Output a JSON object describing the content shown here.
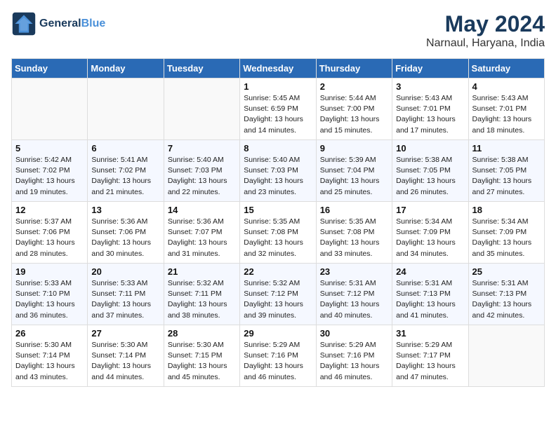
{
  "header": {
    "logo_line1": "General",
    "logo_line2": "Blue",
    "month_year": "May 2024",
    "location": "Narnaul, Haryana, India"
  },
  "weekdays": [
    "Sunday",
    "Monday",
    "Tuesday",
    "Wednesday",
    "Thursday",
    "Friday",
    "Saturday"
  ],
  "weeks": [
    [
      {
        "day": "",
        "info": ""
      },
      {
        "day": "",
        "info": ""
      },
      {
        "day": "",
        "info": ""
      },
      {
        "day": "1",
        "info": "Sunrise: 5:45 AM\nSunset: 6:59 PM\nDaylight: 13 hours and 14 minutes."
      },
      {
        "day": "2",
        "info": "Sunrise: 5:44 AM\nSunset: 7:00 PM\nDaylight: 13 hours and 15 minutes."
      },
      {
        "day": "3",
        "info": "Sunrise: 5:43 AM\nSunset: 7:01 PM\nDaylight: 13 hours and 17 minutes."
      },
      {
        "day": "4",
        "info": "Sunrise: 5:43 AM\nSunset: 7:01 PM\nDaylight: 13 hours and 18 minutes."
      }
    ],
    [
      {
        "day": "5",
        "info": "Sunrise: 5:42 AM\nSunset: 7:02 PM\nDaylight: 13 hours and 19 minutes."
      },
      {
        "day": "6",
        "info": "Sunrise: 5:41 AM\nSunset: 7:02 PM\nDaylight: 13 hours and 21 minutes."
      },
      {
        "day": "7",
        "info": "Sunrise: 5:40 AM\nSunset: 7:03 PM\nDaylight: 13 hours and 22 minutes."
      },
      {
        "day": "8",
        "info": "Sunrise: 5:40 AM\nSunset: 7:03 PM\nDaylight: 13 hours and 23 minutes."
      },
      {
        "day": "9",
        "info": "Sunrise: 5:39 AM\nSunset: 7:04 PM\nDaylight: 13 hours and 25 minutes."
      },
      {
        "day": "10",
        "info": "Sunrise: 5:38 AM\nSunset: 7:05 PM\nDaylight: 13 hours and 26 minutes."
      },
      {
        "day": "11",
        "info": "Sunrise: 5:38 AM\nSunset: 7:05 PM\nDaylight: 13 hours and 27 minutes."
      }
    ],
    [
      {
        "day": "12",
        "info": "Sunrise: 5:37 AM\nSunset: 7:06 PM\nDaylight: 13 hours and 28 minutes."
      },
      {
        "day": "13",
        "info": "Sunrise: 5:36 AM\nSunset: 7:06 PM\nDaylight: 13 hours and 30 minutes."
      },
      {
        "day": "14",
        "info": "Sunrise: 5:36 AM\nSunset: 7:07 PM\nDaylight: 13 hours and 31 minutes."
      },
      {
        "day": "15",
        "info": "Sunrise: 5:35 AM\nSunset: 7:08 PM\nDaylight: 13 hours and 32 minutes."
      },
      {
        "day": "16",
        "info": "Sunrise: 5:35 AM\nSunset: 7:08 PM\nDaylight: 13 hours and 33 minutes."
      },
      {
        "day": "17",
        "info": "Sunrise: 5:34 AM\nSunset: 7:09 PM\nDaylight: 13 hours and 34 minutes."
      },
      {
        "day": "18",
        "info": "Sunrise: 5:34 AM\nSunset: 7:09 PM\nDaylight: 13 hours and 35 minutes."
      }
    ],
    [
      {
        "day": "19",
        "info": "Sunrise: 5:33 AM\nSunset: 7:10 PM\nDaylight: 13 hours and 36 minutes."
      },
      {
        "day": "20",
        "info": "Sunrise: 5:33 AM\nSunset: 7:11 PM\nDaylight: 13 hours and 37 minutes."
      },
      {
        "day": "21",
        "info": "Sunrise: 5:32 AM\nSunset: 7:11 PM\nDaylight: 13 hours and 38 minutes."
      },
      {
        "day": "22",
        "info": "Sunrise: 5:32 AM\nSunset: 7:12 PM\nDaylight: 13 hours and 39 minutes."
      },
      {
        "day": "23",
        "info": "Sunrise: 5:31 AM\nSunset: 7:12 PM\nDaylight: 13 hours and 40 minutes."
      },
      {
        "day": "24",
        "info": "Sunrise: 5:31 AM\nSunset: 7:13 PM\nDaylight: 13 hours and 41 minutes."
      },
      {
        "day": "25",
        "info": "Sunrise: 5:31 AM\nSunset: 7:13 PM\nDaylight: 13 hours and 42 minutes."
      }
    ],
    [
      {
        "day": "26",
        "info": "Sunrise: 5:30 AM\nSunset: 7:14 PM\nDaylight: 13 hours and 43 minutes."
      },
      {
        "day": "27",
        "info": "Sunrise: 5:30 AM\nSunset: 7:14 PM\nDaylight: 13 hours and 44 minutes."
      },
      {
        "day": "28",
        "info": "Sunrise: 5:30 AM\nSunset: 7:15 PM\nDaylight: 13 hours and 45 minutes."
      },
      {
        "day": "29",
        "info": "Sunrise: 5:29 AM\nSunset: 7:16 PM\nDaylight: 13 hours and 46 minutes."
      },
      {
        "day": "30",
        "info": "Sunrise: 5:29 AM\nSunset: 7:16 PM\nDaylight: 13 hours and 46 minutes."
      },
      {
        "day": "31",
        "info": "Sunrise: 5:29 AM\nSunset: 7:17 PM\nDaylight: 13 hours and 47 minutes."
      },
      {
        "day": "",
        "info": ""
      }
    ]
  ]
}
